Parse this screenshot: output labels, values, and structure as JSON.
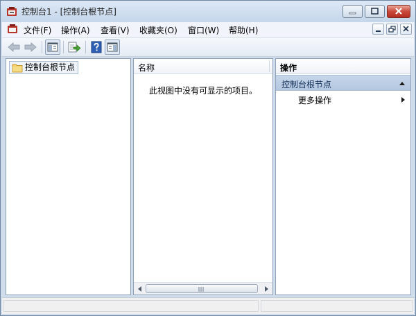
{
  "window": {
    "title": "控制台1 - [控制台根节点]",
    "accent_color": "#cfdceb"
  },
  "menubar": {
    "items": [
      "文件(F)",
      "操作(A)",
      "查看(V)",
      "收藏夹(O)",
      "窗口(W)",
      "帮助(H)"
    ]
  },
  "toolbar": {
    "buttons": [
      "back-arrow-icon",
      "forward-arrow-icon",
      "show-hide-tree-icon",
      "export-list-icon",
      "help-icon",
      "show-hide-action-pane-icon"
    ]
  },
  "tree": {
    "root_label": "控制台根节点"
  },
  "list": {
    "column_name": "名称",
    "empty_message": "此视图中没有可显示的项目。"
  },
  "actions": {
    "header": "操作",
    "section_title": "控制台根节点",
    "more_actions": "更多操作"
  }
}
